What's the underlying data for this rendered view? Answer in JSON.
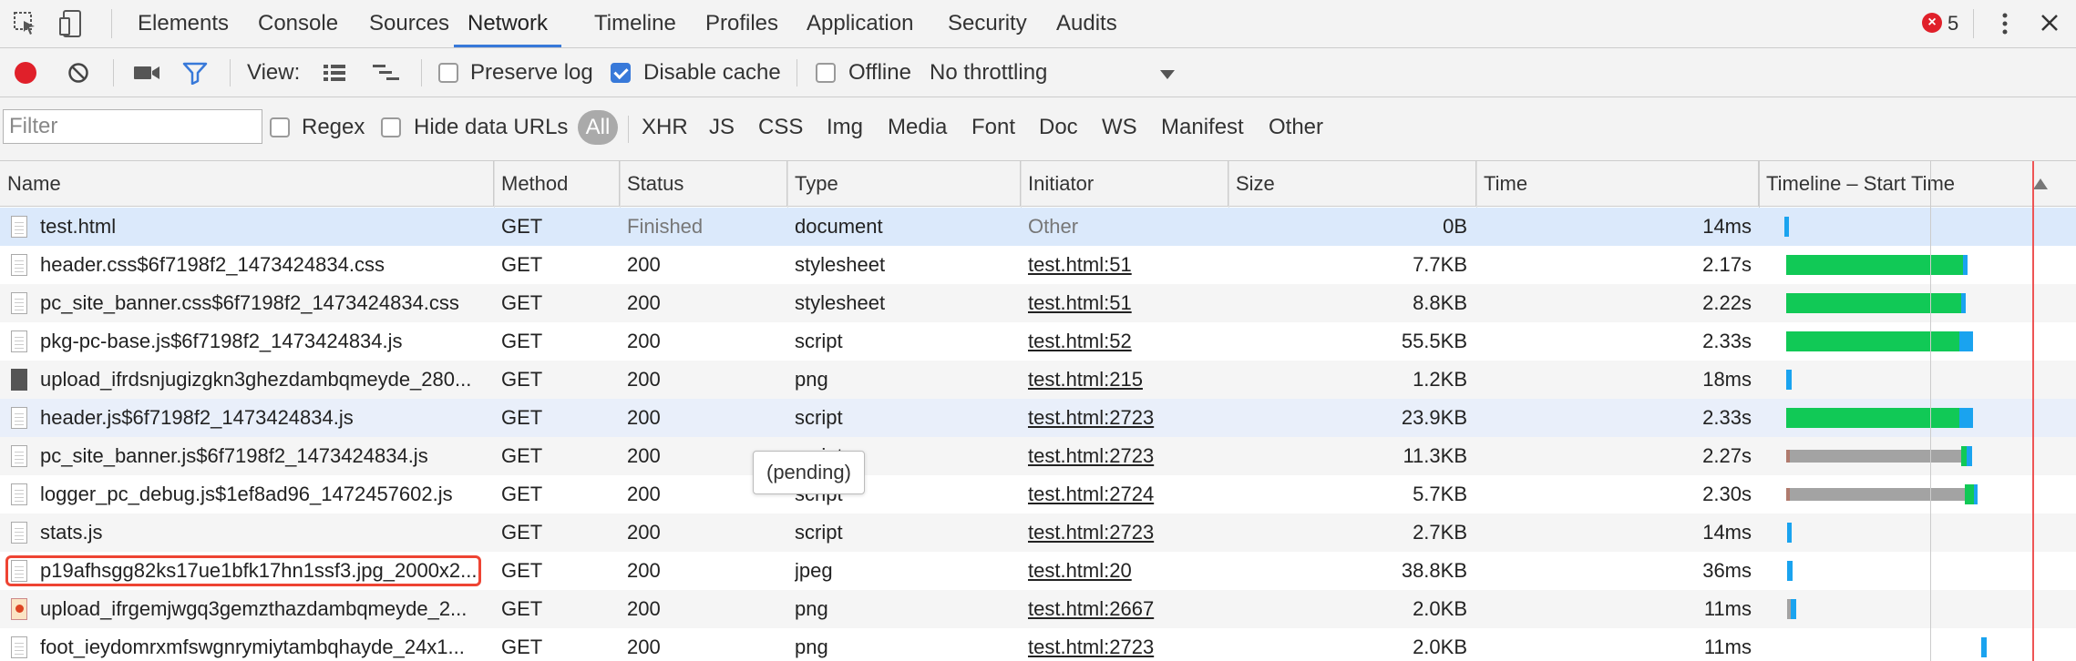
{
  "tabs": [
    "Elements",
    "Console",
    "Sources",
    "Network",
    "Timeline",
    "Profiles",
    "Application",
    "Security",
    "Audits"
  ],
  "error_count": "5",
  "toolbar": {
    "view_label": "View:",
    "preserve_log": "Preserve log",
    "disable_cache": "Disable cache",
    "offline": "Offline",
    "throttling": "No throttling"
  },
  "filter": {
    "placeholder": "Filter",
    "regex": "Regex",
    "hide_data_urls": "Hide data URLs",
    "types": [
      "All",
      "XHR",
      "JS",
      "CSS",
      "Img",
      "Media",
      "Font",
      "Doc",
      "WS",
      "Manifest",
      "Other"
    ]
  },
  "columns": [
    "Name",
    "Method",
    "Status",
    "Type",
    "Initiator",
    "Size",
    "Time",
    "Timeline – Start Time"
  ],
  "rows": [
    {
      "name": "test.html",
      "method": "GET",
      "status": "Finished",
      "type": "document",
      "initiator": "Other",
      "size": "0B",
      "time": "14ms"
    },
    {
      "name": "header.css$6f7198f2_1473424834.css",
      "method": "GET",
      "status": "200",
      "type": "stylesheet",
      "initiator": "test.html:51",
      "size": "7.7KB",
      "time": "2.17s"
    },
    {
      "name": "pc_site_banner.css$6f7198f2_1473424834.css",
      "method": "GET",
      "status": "200",
      "type": "stylesheet",
      "initiator": "test.html:51",
      "size": "8.8KB",
      "time": "2.22s"
    },
    {
      "name": "pkg-pc-base.js$6f7198f2_1473424834.js",
      "method": "GET",
      "status": "200",
      "type": "script",
      "initiator": "test.html:52",
      "size": "55.5KB",
      "time": "2.33s"
    },
    {
      "name": "upload_ifrdsnjugizgkn3ghezdambqmeyde_280...",
      "method": "GET",
      "status": "200",
      "type": "png",
      "initiator": "test.html:215",
      "size": "1.2KB",
      "time": "18ms"
    },
    {
      "name": "header.js$6f7198f2_1473424834.js",
      "method": "GET",
      "status": "200",
      "type": "script",
      "initiator": "test.html:2723",
      "size": "23.9KB",
      "time": "2.33s"
    },
    {
      "name": "pc_site_banner.js$6f7198f2_1473424834.js",
      "method": "GET",
      "status": "200",
      "type": "script",
      "initiator": "test.html:2723",
      "size": "11.3KB",
      "time": "2.27s"
    },
    {
      "name": "logger_pc_debug.js$1ef8ad96_1472457602.js",
      "method": "GET",
      "status": "200",
      "type": "script",
      "initiator": "test.html:2724",
      "size": "5.7KB",
      "time": "2.30s"
    },
    {
      "name": "stats.js",
      "method": "GET",
      "status": "200",
      "type": "script",
      "initiator": "test.html:2723",
      "size": "2.7KB",
      "time": "14ms"
    },
    {
      "name": "p19afhsgg82ks17ue1bfk17hn1ssf3.jpg_2000x2...",
      "method": "GET",
      "status": "200",
      "type": "jpeg",
      "initiator": "test.html:20",
      "size": "38.8KB",
      "time": "36ms"
    },
    {
      "name": "upload_ifrgemjwgq3gemzthazdambqmeyde_2...",
      "method": "GET",
      "status": "200",
      "type": "png",
      "initiator": "test.html:2667",
      "size": "2.0KB",
      "time": "11ms"
    },
    {
      "name": "foot_ieydomrxmfswgnrymiytambqhayde_24x1...",
      "method": "GET",
      "status": "200",
      "type": "png",
      "initiator": "test.html:2723",
      "size": "2.0KB",
      "time": "11ms"
    }
  ],
  "tooltip": "(pending)",
  "colors": {
    "accent": "#3879d9",
    "record": "#e0202a",
    "download": "#11c956",
    "waiting": "#1aa3ef",
    "stalled": "#a3a3a3",
    "selected_row": "#dbe9fb",
    "highlight": "#e43"
  }
}
